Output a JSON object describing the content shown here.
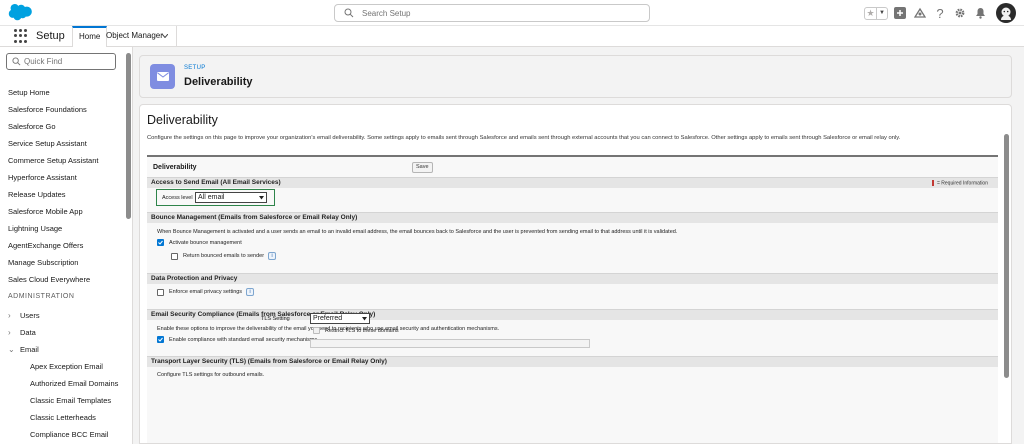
{
  "header": {
    "search_placeholder": "Search Setup"
  },
  "context": {
    "app_name": "Setup",
    "tabs": [
      {
        "label": "Home"
      },
      {
        "label": "Object Manager"
      }
    ]
  },
  "sidebar": {
    "quick_find_placeholder": "Quick Find",
    "items": [
      "Setup Home",
      "Salesforce Foundations",
      "Salesforce Go",
      "Service Setup Assistant",
      "Commerce Setup Assistant",
      "Hyperforce Assistant",
      "Release Updates",
      "Salesforce Mobile App",
      "Lightning Usage",
      "AgentExchange Offers",
      "Manage Subscription",
      "Sales Cloud Everywhere"
    ],
    "admin_heading": "ADMINISTRATION",
    "tree": [
      "Users",
      "Data",
      "Email"
    ],
    "email_children": [
      "Apex Exception Email",
      "Authorized Email Domains",
      "Classic Email Templates",
      "Classic Letterheads",
      "Compliance BCC Email"
    ]
  },
  "page_header": {
    "breadcrumb": "SETUP",
    "title": "Deliverability"
  },
  "content": {
    "title": "Deliverability",
    "description": "Configure the settings on this page to improve your organization's email deliverability. Some settings apply to emails sent through Salesforce and emails sent through external accounts that you can connect to Salesforce. Other settings apply to emails sent through Salesforce or email relay only.",
    "block_title": "Deliverability",
    "save_label": "Save",
    "required_info": "= Required Information",
    "sections": {
      "access": {
        "title": "Access to Send Email (All Email Services)",
        "access_level_label": "Access level",
        "access_level_value": "All email"
      },
      "bounce": {
        "title": "Bounce Management (Emails from Salesforce or Email Relay Only)",
        "text": "When Bounce Management is activated and a user sends an email to an invalid email address, the email bounces back to Salesforce and the user is prevented from sending email to that address until it is validated.",
        "activate_label": "Activate bounce management",
        "activate_checked": true,
        "return_label": "Return bounced emails to sender",
        "return_checked": false
      },
      "privacy": {
        "title": "Data Protection and Privacy",
        "enforce_label": "Enforce email privacy settings",
        "enforce_checked": false
      },
      "compliance": {
        "title": "Email Security Compliance (Emails from Salesforce or Email Relay Only)",
        "text": "Enable these options to improve the deliverability of the email you send to recipients who use email security and authentication mechanisms.",
        "enable_label": "Enable compliance with standard email security mechanisms",
        "enable_checked": true
      },
      "tls": {
        "title": "Transport Layer Security (TLS) (Emails from Salesforce or Email Relay Only)",
        "text": "Configure TLS settings for outbound emails.",
        "setting_label": "TLS Setting",
        "setting_value": "Preferred",
        "restrict_label": "Restrict TLS to these domains",
        "restrict_checked": false
      }
    }
  },
  "colors": {
    "brand_blue": "#0176d3",
    "page_icon": "#7f8de1",
    "highlight_green": "#2e844a",
    "required_red": "#c23934"
  }
}
